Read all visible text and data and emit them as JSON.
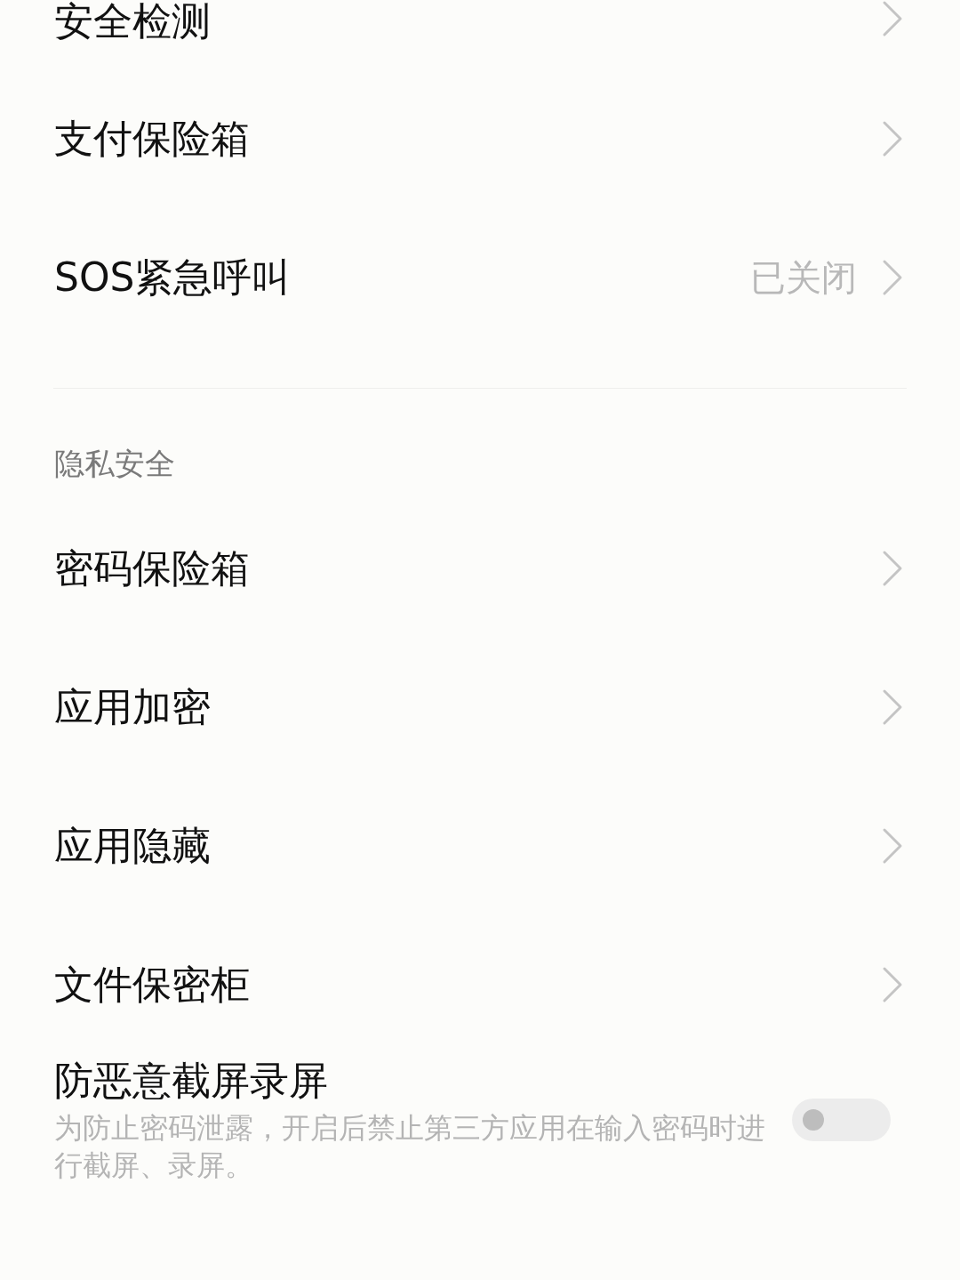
{
  "top_items": [
    {
      "label": "安全检测"
    },
    {
      "label": "支付保险箱"
    },
    {
      "label": "SOS紧急呼叫",
      "value": "已关闭"
    }
  ],
  "section": {
    "title": "隐私安全",
    "items": [
      {
        "label": "密码保险箱"
      },
      {
        "label": "应用加密"
      },
      {
        "label": "应用隐藏"
      },
      {
        "label": "文件保密柜"
      }
    ]
  },
  "toggle_row": {
    "label": "防恶意截屏录屏",
    "description": "为防止密码泄露，开启后禁止第三方应用在输入密码时进行截屏、录屏。",
    "on": false
  }
}
